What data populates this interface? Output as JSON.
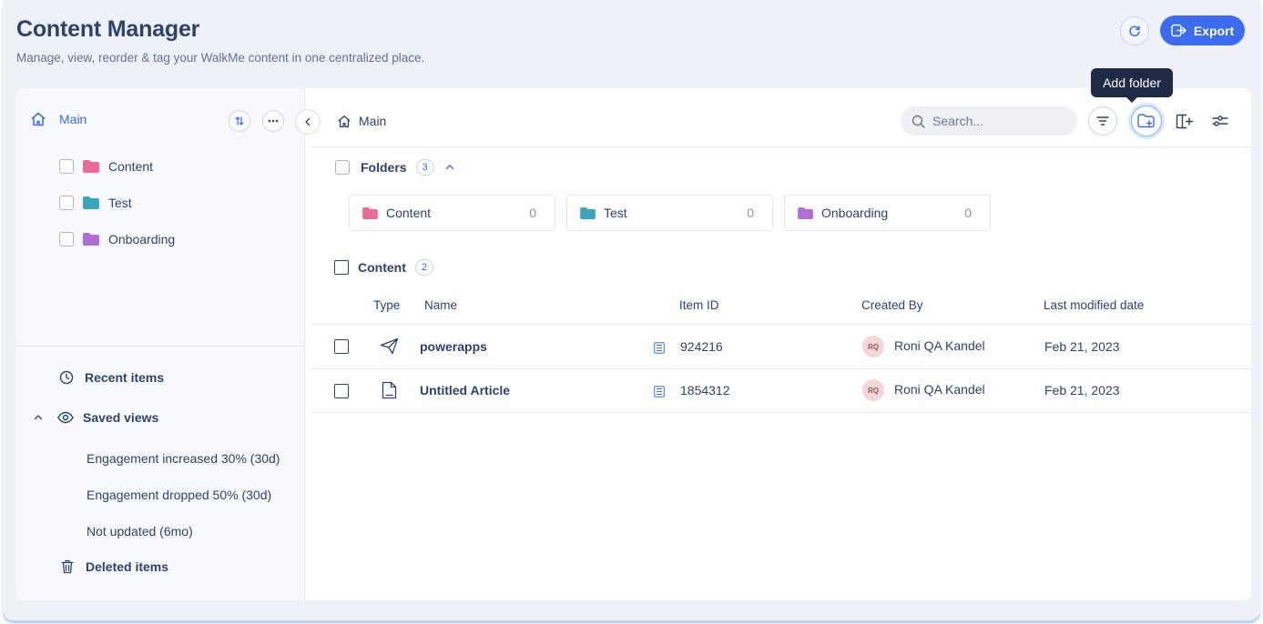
{
  "header": {
    "title": "Content Manager",
    "subtitle": "Manage, view, reorder & tag your WalkMe content in one centralized place.",
    "export_label": "Export"
  },
  "sidebar": {
    "root_label": "Main",
    "tree": [
      {
        "label": "Content",
        "color": "#ec6a96"
      },
      {
        "label": "Test",
        "color": "#3aa5bb"
      },
      {
        "label": "Onboarding",
        "color": "#b06ed8"
      }
    ],
    "recent_items": "Recent items",
    "saved_views_label": "Saved views",
    "saved_views": [
      "Engagement increased 30% (30d)",
      "Engagement dropped 50% (30d)",
      "Not updated (6mo)"
    ],
    "deleted_items": "Deleted items"
  },
  "toolbar": {
    "breadcrumb": "Main",
    "search_placeholder": "Search...",
    "tooltip": "Add folder"
  },
  "folders_section": {
    "label": "Folders",
    "count": "3",
    "cards": [
      {
        "name": "Content",
        "count": "0",
        "color": "#ec6a96"
      },
      {
        "name": "Test",
        "count": "0",
        "color": "#3aa5bb"
      },
      {
        "name": "Onboarding",
        "count": "0",
        "color": "#b06ed8"
      }
    ]
  },
  "content_section": {
    "label": "Content",
    "count": "2",
    "columns": {
      "type": "Type",
      "name": "Name",
      "item_id": "Item ID",
      "created_by": "Created By",
      "last_modified": "Last modified date"
    },
    "rows": [
      {
        "type_icon": "paper-plane-icon",
        "name": "powerapps",
        "item_id": "924216",
        "initials": "RQ",
        "created_by": "Roni QA Kandel",
        "last_modified": "Feb 21, 2023"
      },
      {
        "type_icon": "document-icon",
        "name": "Untitled Article",
        "item_id": "1854312",
        "initials": "RQ",
        "created_by": "Roni QA Kandel",
        "last_modified": "Feb 21, 2023"
      }
    ]
  },
  "colors": {
    "accent": "#3b6cf0",
    "text": "#2f426c",
    "tooltip_bg": "#1f2b45"
  }
}
